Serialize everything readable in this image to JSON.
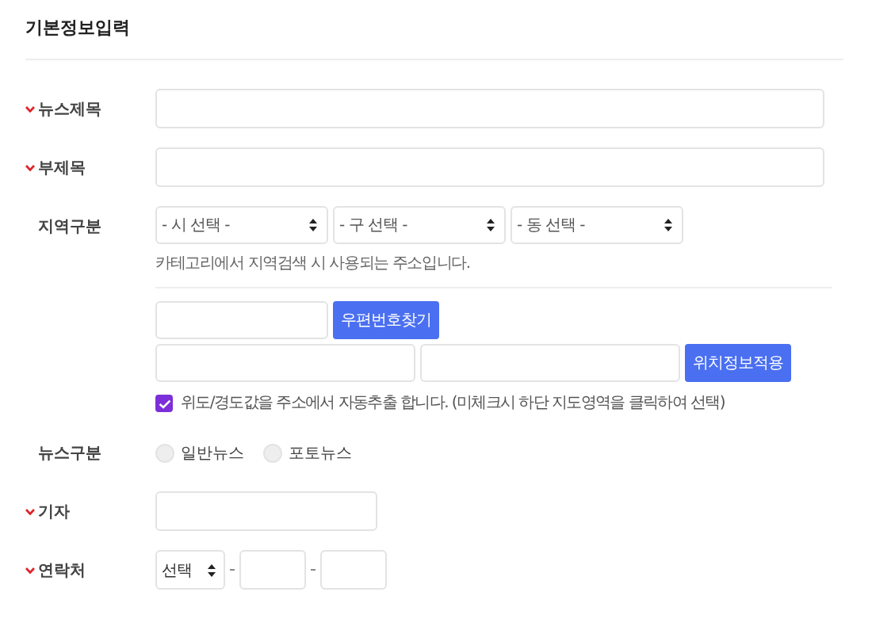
{
  "section_title": "기본정보입력",
  "fields": [
    {
      "kind": "text",
      "label": "뉴스제목",
      "required": true
    },
    {
      "kind": "text",
      "label": "부제목",
      "required": true
    },
    {
      "kind": "region",
      "label": "지역구분",
      "required": false,
      "selects": [
        "- 시 선택 -",
        "- 구 선택 -",
        "- 동 선택 -"
      ],
      "help": "카테고리에서 지역검색 시 사용되는 주소입니다.",
      "postcode_button": "우편번호찾기",
      "location_button": "위치정보적용",
      "auto_extract": {
        "checked": true,
        "label": "위도/경도값을 주소에서 자동추출 합니다. (미체크시 하단 지도영역을 클릭하여 선택)"
      }
    },
    {
      "kind": "radio",
      "label": "뉴스구분",
      "required": false,
      "options": [
        {
          "label": "일반뉴스",
          "selected": false
        },
        {
          "label": "포토뉴스",
          "selected": false
        }
      ]
    },
    {
      "kind": "short_text",
      "label": "기자",
      "required": true
    },
    {
      "kind": "phone",
      "label": "연락처",
      "required": true,
      "select": "선택"
    }
  ]
}
